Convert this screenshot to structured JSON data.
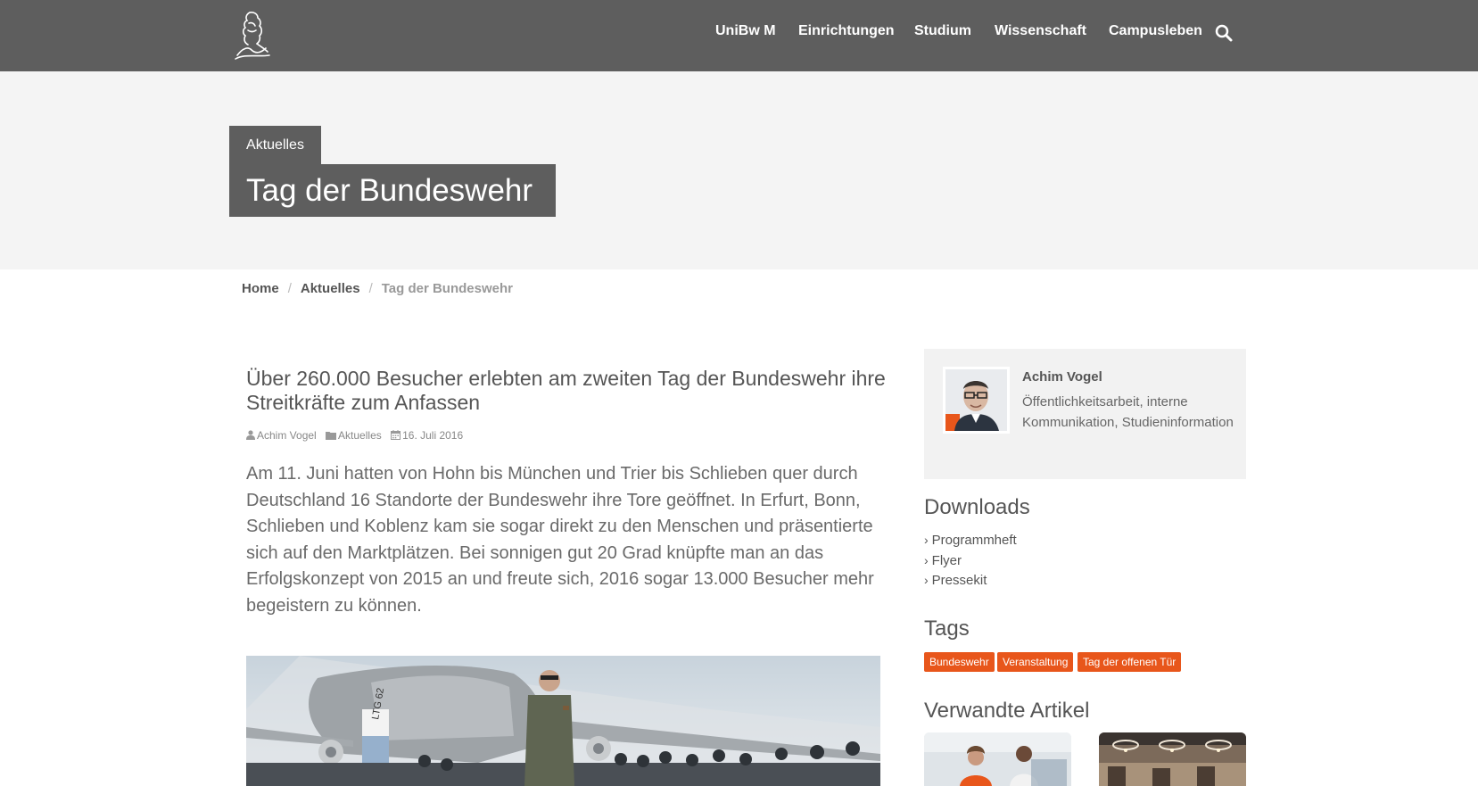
{
  "nav": {
    "logo": "university-logo",
    "items": [
      {
        "label": "UniBw M"
      },
      {
        "label": "Einrichtungen"
      },
      {
        "label": "Studium"
      },
      {
        "label": "Wissenschaft"
      },
      {
        "label": "Campusleben"
      }
    ],
    "search_icon": "search-icon"
  },
  "header": {
    "section": "Aktuelles",
    "title": "Tag der Bundeswehr"
  },
  "breadcrumb": {
    "items": [
      "Home",
      "Aktuelles"
    ],
    "current": "Tag der Bundeswehr",
    "separator": "/"
  },
  "article": {
    "headline": "Über 260.000 Besucher erlebten am zweiten Tag der Bundeswehr ihre Streitkräfte zum Anfassen",
    "meta": {
      "author": "Achim Vogel",
      "category": "Aktuelles",
      "date": "16. Juli 2016"
    },
    "lead": "Am 11. Juni hatten von Hohn bis München und Trier bis Schlieben quer durch Deutschland 16 Standorte der Bundeswehr ihre Tore geöffnet. In Erfurt, Bonn, Schlieben und Koblenz kam sie sogar direkt zu den Menschen und präsentierte sich auf den Marktplätzen. Bei sonnigen gut 20 Grad knüpfte man an das Erfolgskonzept von 2015 an und freute sich, 2016 sogar 13.000 Besucher mehr begeistern zu können.",
    "image_banner_text": "LTG 62"
  },
  "sidebar": {
    "author": {
      "name": "Achim Vogel",
      "role": "Öffentlichkeitsarbeit, interne Kommunikation, Studieninformation"
    },
    "downloads": {
      "heading": "Downloads",
      "items": [
        "Programmheft",
        "Flyer",
        "Pressekit"
      ]
    },
    "tags": {
      "heading": "Tags",
      "items": [
        "Bundeswehr",
        "Veranstaltung",
        "Tag der offenen Tür"
      ]
    },
    "related": {
      "heading": "Verwandte Artikel"
    }
  },
  "colors": {
    "header_bg": "#5e5e5e",
    "band_bg": "#f4f4f4",
    "tag_bg": "#e8561b",
    "text": "#555555"
  }
}
